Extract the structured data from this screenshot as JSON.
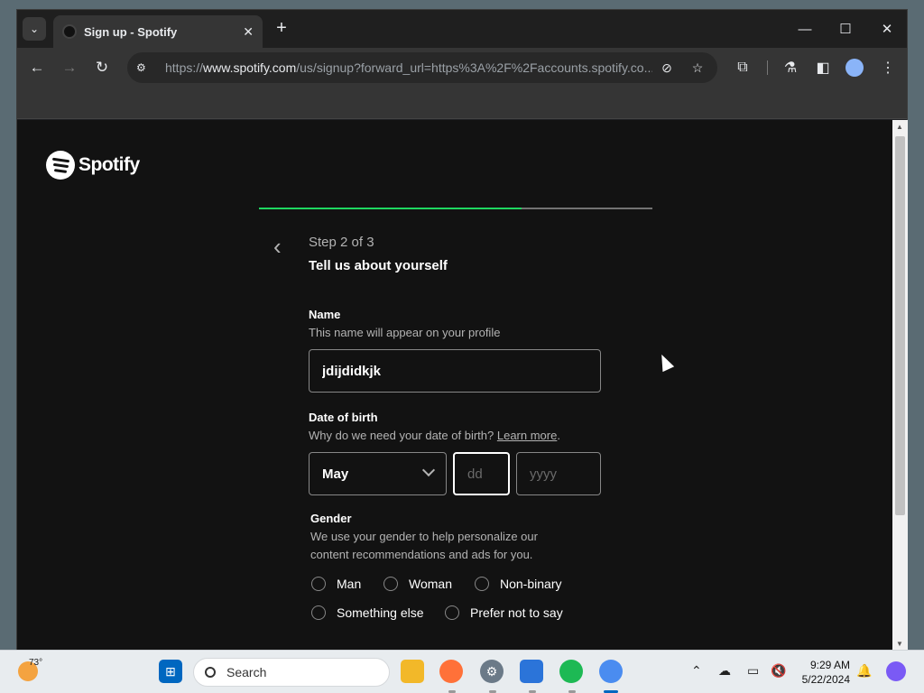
{
  "browser": {
    "tab_title": "Sign up - Spotify",
    "url_scheme": "https://",
    "url_host": "www.spotify.com",
    "url_path": "/us/signup?forward_url=https%3A%2F%2Faccounts.spotify.co...",
    "icons": {
      "tab_search": "chevron-down-icon",
      "close_tab": "close-icon",
      "new_tab": "plus-icon",
      "minimize": "minimize-icon",
      "maximize": "maximize-icon",
      "close_window": "close-icon",
      "back": "arrow-left-icon",
      "forward": "arrow-right-icon",
      "reload": "reload-icon",
      "site_info": "tune-icon",
      "eye_off": "eye-off-icon",
      "bookmark": "star-icon",
      "extensions": "puzzle-icon",
      "labs": "flask-icon",
      "side_panel": "side-panel-icon",
      "profile": "account-icon",
      "menu": "more-vert-icon"
    }
  },
  "page": {
    "logo_text": "Spotify",
    "progress": {
      "step": 2,
      "total": 3,
      "fraction": 0.667,
      "fill_color": "#1ed760",
      "track_color": "#727272"
    },
    "step_label": "Step 2 of 3",
    "step_title": "Tell us about yourself",
    "name": {
      "label": "Name",
      "help": "This name will appear on your profile",
      "value": "jdijdidkjk"
    },
    "dob": {
      "label": "Date of birth",
      "help": "Why do we need your date of birth?",
      "help_link": "Learn more",
      "help_suffix": ".",
      "month": "May",
      "day_placeholder": "dd",
      "year_placeholder": "yyyy"
    },
    "gender": {
      "label": "Gender",
      "help_line1": "We use your gender to help personalize our",
      "help_line2": "content recommendations and ads for you.",
      "options": [
        "Man",
        "Woman",
        "Non-binary",
        "Something else",
        "Prefer not to say"
      ]
    },
    "colors": {
      "background": "#121212",
      "text": "#ffffff",
      "muted": "#b3b3b3",
      "accent": "#1ed760"
    }
  },
  "taskbar": {
    "weather_temp": "73°",
    "search_placeholder": "Search",
    "time": "9:29 AM",
    "date": "5/22/2024",
    "apps": [
      "windows-start-icon",
      "file-explorer-icon",
      "firefox-icon",
      "settings-icon",
      "store-icon",
      "spotify-icon",
      "chrome-icon"
    ],
    "tray_icons": [
      "chevron-up-icon",
      "onedrive-icon",
      "display-icon",
      "volume-muted-icon",
      "bell-icon",
      "copilot-icon"
    ]
  }
}
